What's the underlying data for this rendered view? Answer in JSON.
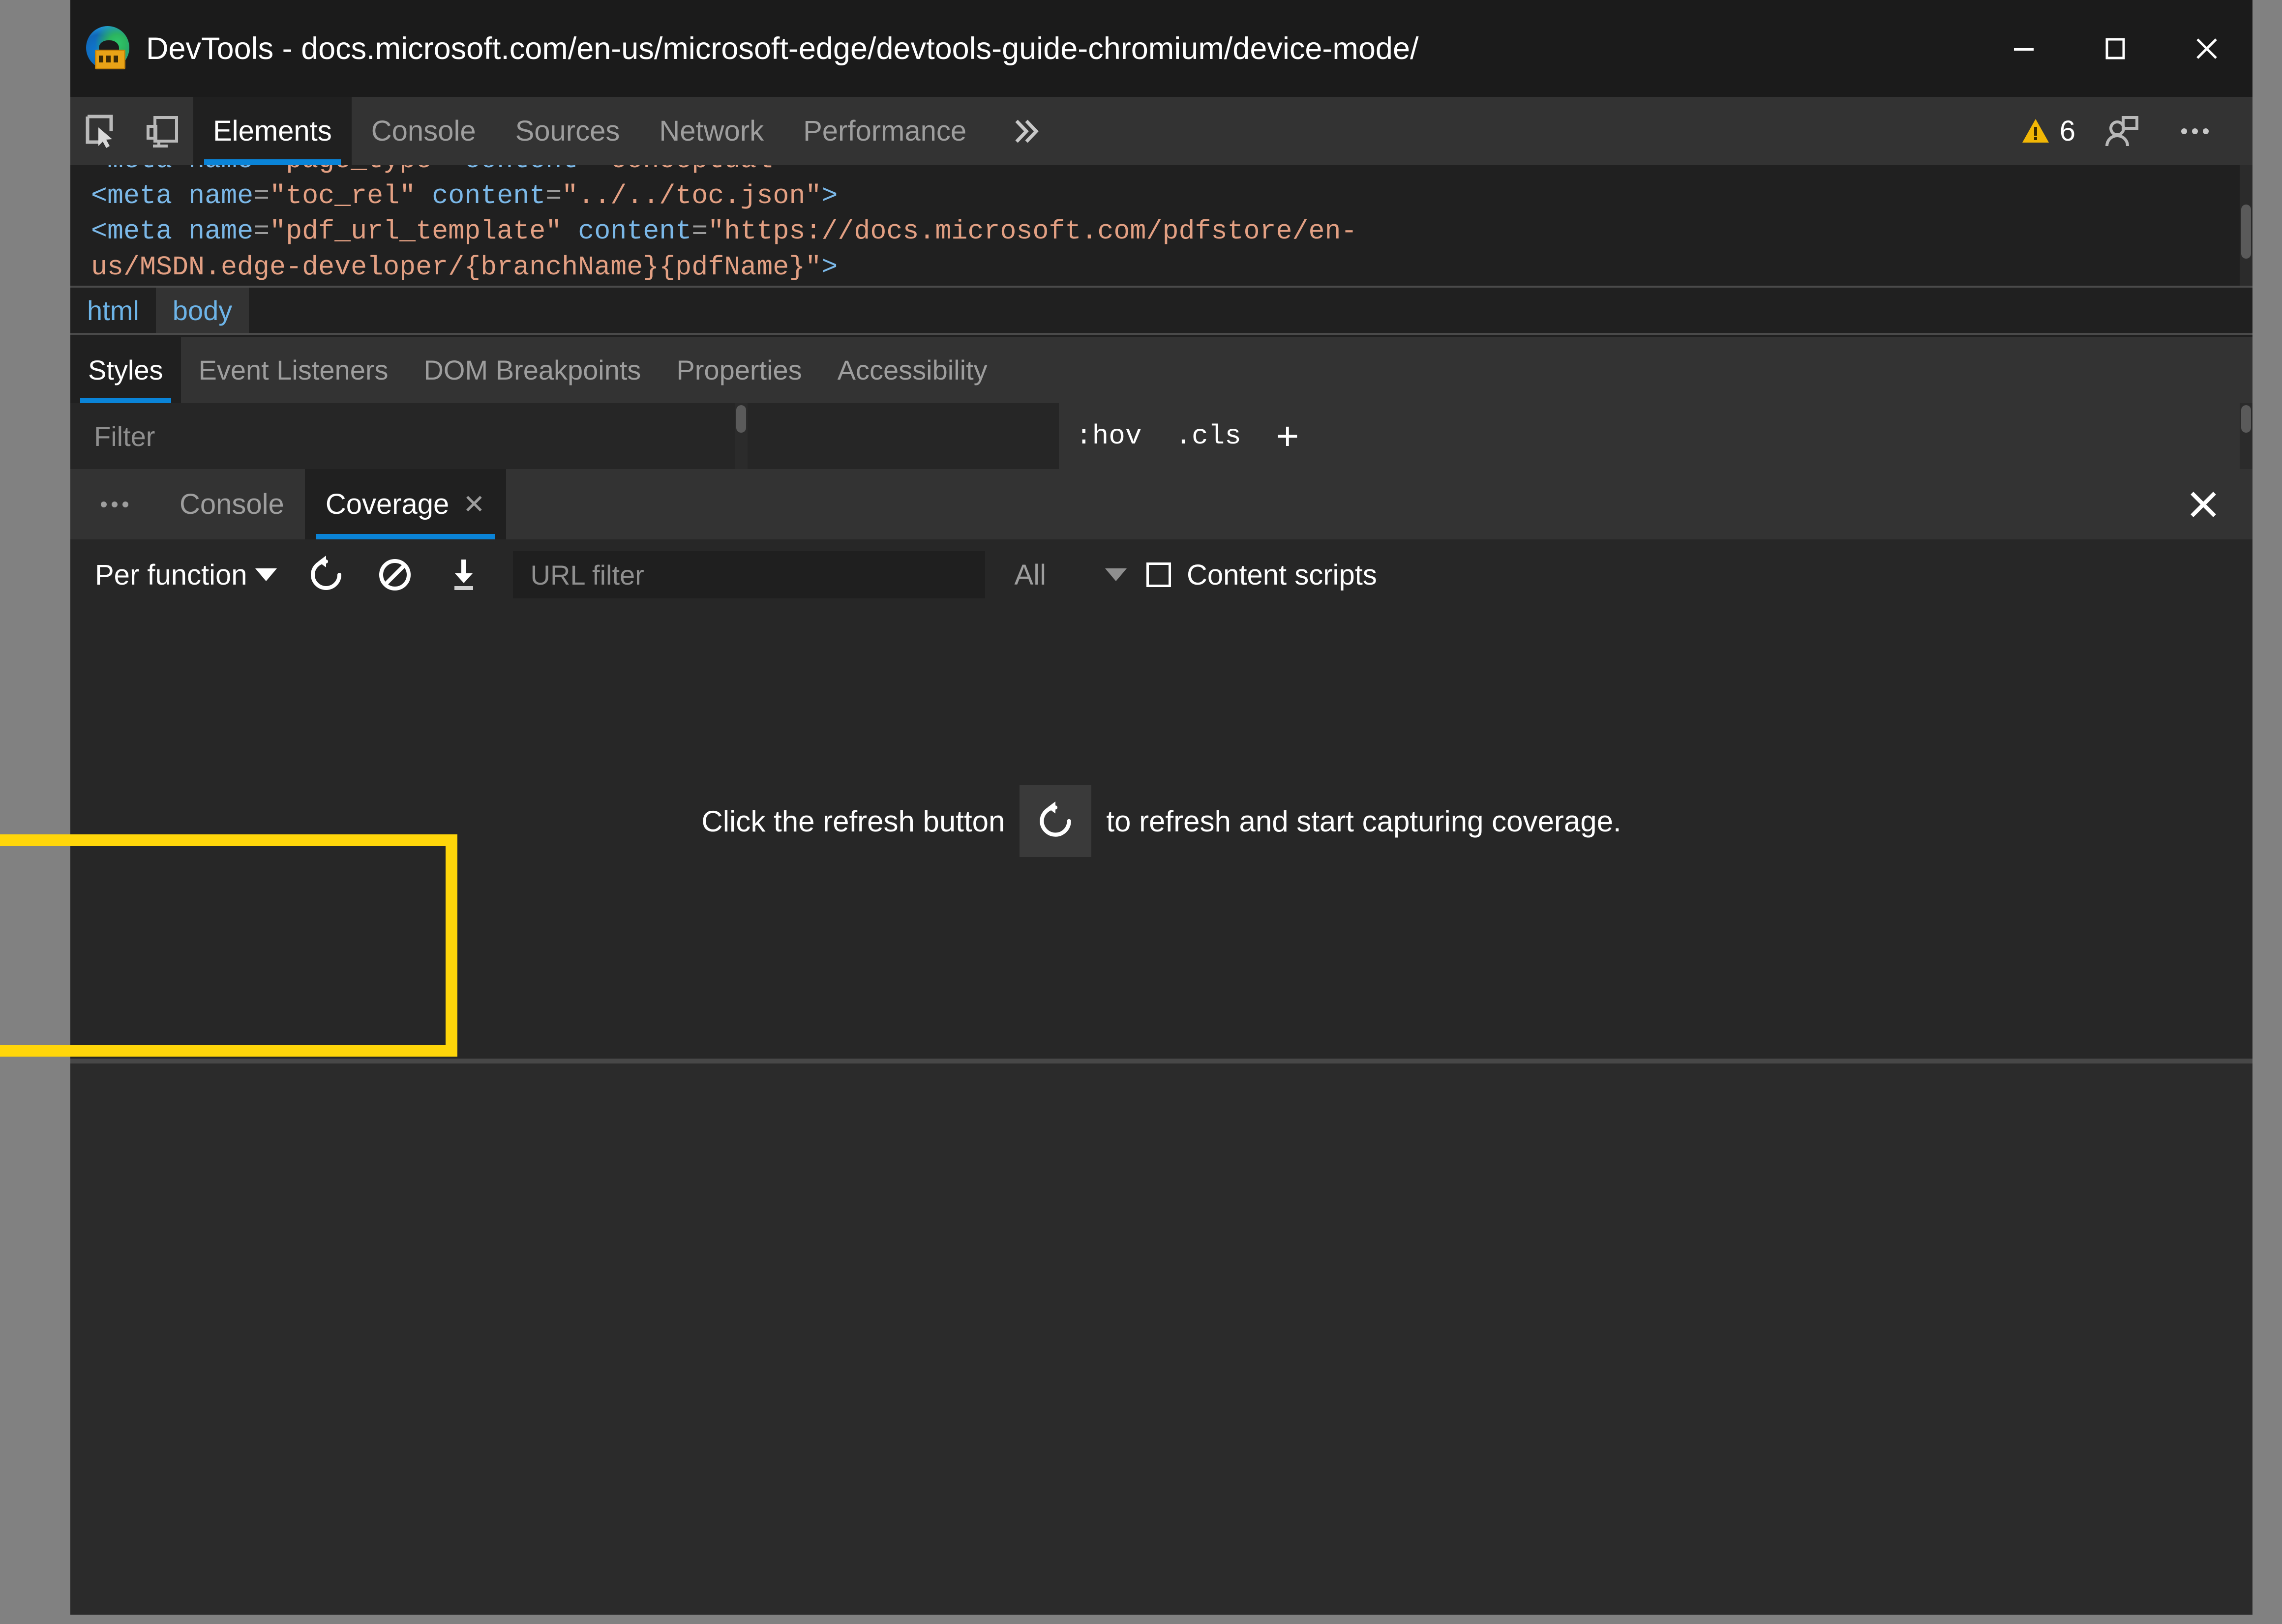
{
  "window": {
    "title": "DevTools - docs.microsoft.com/en-us/microsoft-edge/devtools-guide-chromium/device-mode/",
    "app_icon": "edge-devtools-icon",
    "controls": {
      "minimize": "minimize-icon",
      "maximize": "maximize-icon",
      "close": "close-icon"
    }
  },
  "main_toolbar": {
    "inspect_icon": "inspect-element-icon",
    "device_icon": "device-emulation-icon",
    "tabs": [
      {
        "label": "Elements",
        "active": true
      },
      {
        "label": "Console",
        "active": false
      },
      {
        "label": "Sources",
        "active": false
      },
      {
        "label": "Network",
        "active": false
      },
      {
        "label": "Performance",
        "active": false
      }
    ],
    "more_tabs_icon": "chevron-double-right-icon",
    "warning_icon": "warning-triangle-icon",
    "warning_count": "6",
    "feedback_icon": "send-feedback-icon",
    "menu_icon": "more-vertical-icon"
  },
  "elements": {
    "code_lines": [
      [
        {
          "t": "pun",
          "s": "<"
        },
        {
          "t": "tag",
          "s": "meta"
        },
        {
          "t": "plain",
          "s": " "
        },
        {
          "t": "attr",
          "s": "name"
        },
        {
          "t": "eq",
          "s": "="
        },
        {
          "t": "val",
          "s": "\"page_type\""
        },
        {
          "t": "plain",
          "s": " "
        },
        {
          "t": "attr",
          "s": "content"
        },
        {
          "t": "eq",
          "s": "="
        },
        {
          "t": "val",
          "s": "\"conceptual\""
        },
        {
          "t": "pun",
          "s": ">"
        }
      ],
      [
        {
          "t": "pun",
          "s": "<"
        },
        {
          "t": "tag",
          "s": "meta"
        },
        {
          "t": "plain",
          "s": " "
        },
        {
          "t": "attr",
          "s": "name"
        },
        {
          "t": "eq",
          "s": "="
        },
        {
          "t": "val",
          "s": "\"toc_rel\""
        },
        {
          "t": "plain",
          "s": " "
        },
        {
          "t": "attr",
          "s": "content"
        },
        {
          "t": "eq",
          "s": "="
        },
        {
          "t": "val",
          "s": "\"../../toc.json\""
        },
        {
          "t": "pun",
          "s": ">"
        }
      ],
      [
        {
          "t": "pun",
          "s": "<"
        },
        {
          "t": "tag",
          "s": "meta"
        },
        {
          "t": "plain",
          "s": " "
        },
        {
          "t": "attr",
          "s": "name"
        },
        {
          "t": "eq",
          "s": "="
        },
        {
          "t": "val",
          "s": "\"pdf_url_template\""
        },
        {
          "t": "plain",
          "s": " "
        },
        {
          "t": "attr",
          "s": "content"
        },
        {
          "t": "eq",
          "s": "="
        },
        {
          "t": "val",
          "s": "\"https://docs.microsoft.com/pdfstore/en-"
        }
      ],
      [
        {
          "t": "val",
          "s": "us/MSDN.edge-developer/{branchName}{pdfName}\""
        },
        {
          "t": "pun",
          "s": ">"
        }
      ]
    ]
  },
  "breadcrumb": {
    "items": [
      {
        "label": "html",
        "selected": false
      },
      {
        "label": "body",
        "selected": true
      }
    ]
  },
  "styles_panel": {
    "tabs": [
      {
        "label": "Styles",
        "active": true
      },
      {
        "label": "Event Listeners",
        "active": false
      },
      {
        "label": "DOM Breakpoints",
        "active": false
      },
      {
        "label": "Properties",
        "active": false
      },
      {
        "label": "Accessibility",
        "active": false
      }
    ],
    "filter_placeholder": "Filter",
    "filter_value": "",
    "hov_label": ":hov",
    "cls_label": ".cls",
    "new_rule_label": "+"
  },
  "drawer": {
    "more_icon": "more-horizontal-icon",
    "tabs": [
      {
        "label": "Console",
        "active": false,
        "closable": false
      },
      {
        "label": "Coverage",
        "active": true,
        "closable": true,
        "close_icon": "close-tab-icon"
      }
    ],
    "close_icon": "close-drawer-icon"
  },
  "coverage": {
    "mode_label": "Per function",
    "mode_caret": "chevron-down-icon",
    "reload_icon": "refresh-icon",
    "clear_icon": "clear-all-icon",
    "export_icon": "download-icon",
    "url_filter_placeholder": "URL filter",
    "url_filter_value": "",
    "type_filter_label": "All",
    "type_filter_caret": "chevron-down-icon",
    "content_scripts_label": "Content scripts",
    "content_scripts_checked": false,
    "empty_message_before": "Click the refresh button",
    "empty_message_icon": "refresh-icon",
    "empty_message_after": "to refresh and start capturing coverage."
  },
  "annotation": {
    "highlight_color": "#ffd60a",
    "target": "per-function-dropdown"
  }
}
